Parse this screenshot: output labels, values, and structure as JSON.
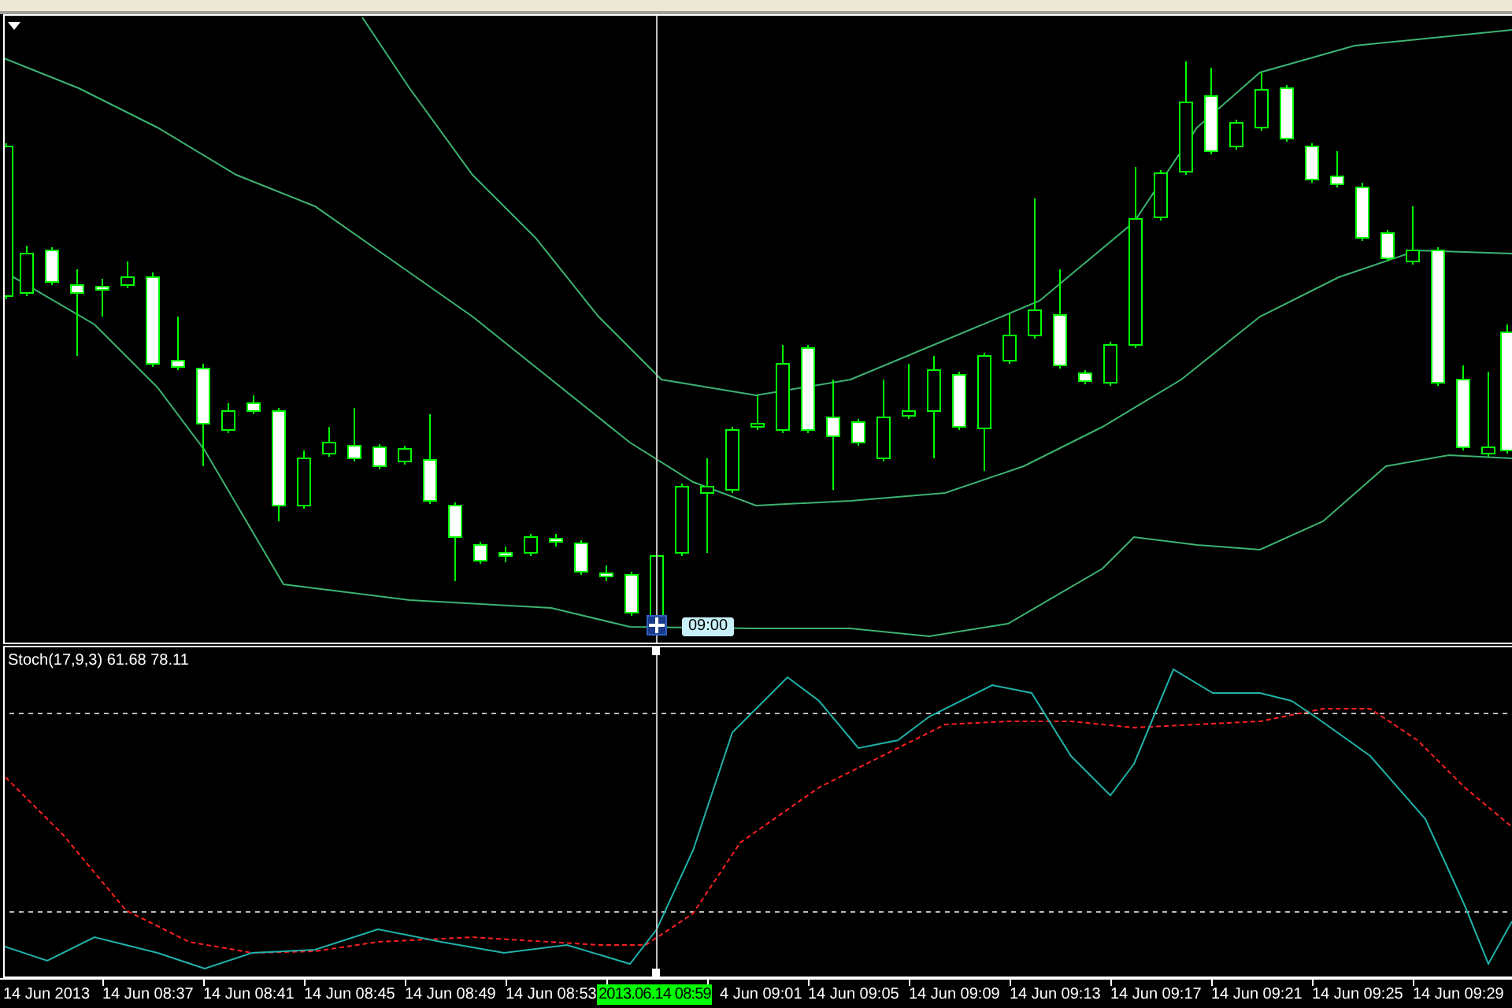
{
  "main_chart": {
    "crosshair_time_label": "09:00"
  },
  "stochastic": {
    "label": "Stoch(17,9,3) 61.68 78.11"
  },
  "time_axis": {
    "labels": [
      "14 Jun 2013",
      "14 Jun 08:37",
      "14 Jun 08:41",
      "14 Jun 08:45",
      "14 Jun 08:49",
      "14 Jun 08:53",
      "4 Jun 09:01",
      "14 Jun 09:05",
      "14 Jun 09:09",
      "14 Jun 09:13",
      "14 Jun 09:17",
      "14 Jun 09:21",
      "14 Jun 09:25",
      "14 Jun 09:29"
    ],
    "cursor_label": "2013.06.14 08:59"
  }
}
